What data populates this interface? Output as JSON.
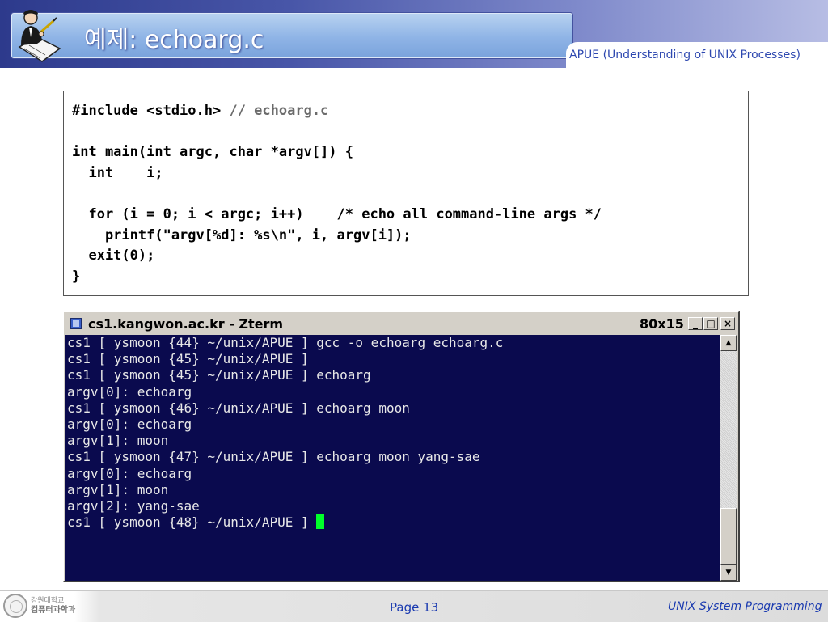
{
  "header": {
    "title": "예제: echoarg.c",
    "subtitle": "APUE (Understanding of UNIX Processes)"
  },
  "code": {
    "lines": [
      {
        "code": "#include <stdio.h> ",
        "comment": "// echoarg.c"
      },
      {
        "code": "",
        "comment": ""
      },
      {
        "code": "int main(int argc, char *argv[]) {",
        "comment": ""
      },
      {
        "code": "  int    i;",
        "comment": ""
      },
      {
        "code": "",
        "comment": ""
      },
      {
        "code": "  for (i = 0; i < argc; i++)    /* echo all command-line args */",
        "comment": ""
      },
      {
        "code": "    printf(\"argv[%d]: %s\\n\", i, argv[i]);",
        "comment": ""
      },
      {
        "code": "  exit(0);",
        "comment": ""
      },
      {
        "code": "}",
        "comment": ""
      }
    ]
  },
  "terminal": {
    "title": "cs1.kangwon.ac.kr - Zterm",
    "size": "80x15",
    "buttons": {
      "minimize": "_",
      "maximize": "□",
      "close": "×"
    },
    "lines": [
      "cs1 [ ysmoon {44} ~/unix/APUE ] gcc -o echoarg echoarg.c",
      "cs1 [ ysmoon {45} ~/unix/APUE ]",
      "cs1 [ ysmoon {45} ~/unix/APUE ] echoarg",
      "argv[0]: echoarg",
      "cs1 [ ysmoon {46} ~/unix/APUE ] echoarg moon",
      "argv[0]: echoarg",
      "argv[1]: moon",
      "cs1 [ ysmoon {47} ~/unix/APUE ] echoarg moon yang-sae",
      "argv[0]: echoarg",
      "argv[1]: moon",
      "argv[2]: yang-sae",
      "cs1 [ ysmoon {48} ~/unix/APUE ] "
    ],
    "cursor_color": "#00ff2a",
    "screen_color": "#0a0a4e"
  },
  "footer": {
    "logo_text_line1": "강원대학교",
    "logo_text_line2": "컴퓨터과학과",
    "page": "Page 13",
    "course": "UNIX System Programming"
  },
  "colors": {
    "accent": "#2e48b0",
    "header_dark": "#2d3a8c",
    "title_box": "#8fb4e6"
  }
}
